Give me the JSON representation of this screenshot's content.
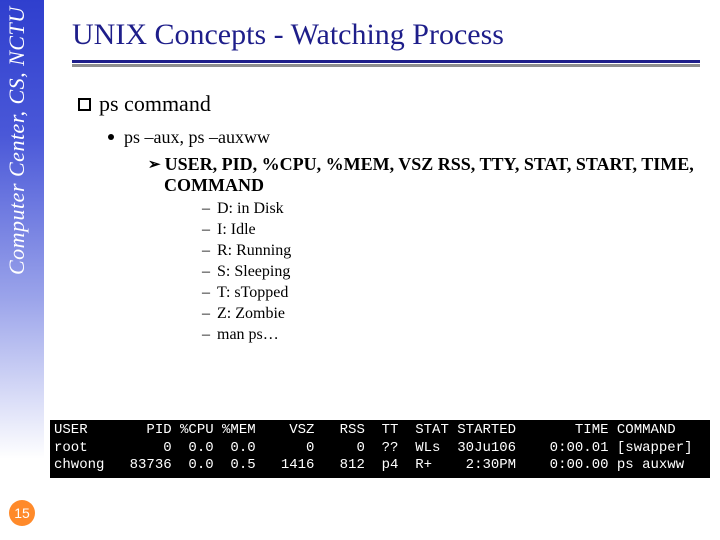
{
  "sidebar_label": "Computer Center, CS, NCTU",
  "title": "UNIX Concepts - Watching Process",
  "section": {
    "heading": "ps command",
    "sub": "ps –aux, ps –auxww",
    "fields_line": "USER, PID, %CPU, %MEM, VSZ RSS, TTY, STAT, START, TIME, COMMAND",
    "states": [
      "D: in Disk",
      "I: Idle",
      "R: Running",
      "S: Sleeping",
      "T: sTopped",
      "Z: Zombie",
      "man ps…"
    ]
  },
  "terminal": {
    "header": "USER       PID %CPU %MEM    VSZ   RSS  TT  STAT STARTED       TIME COMMAND",
    "rows": [
      "root         0  0.0  0.0      0     0  ??  WLs  30Ju106    0:00.01 [swapper]",
      "chwong   83736  0.0  0.5   1416   812  p4  R+    2:30PM    0:00.00 ps auxww"
    ]
  },
  "page_number": "15"
}
